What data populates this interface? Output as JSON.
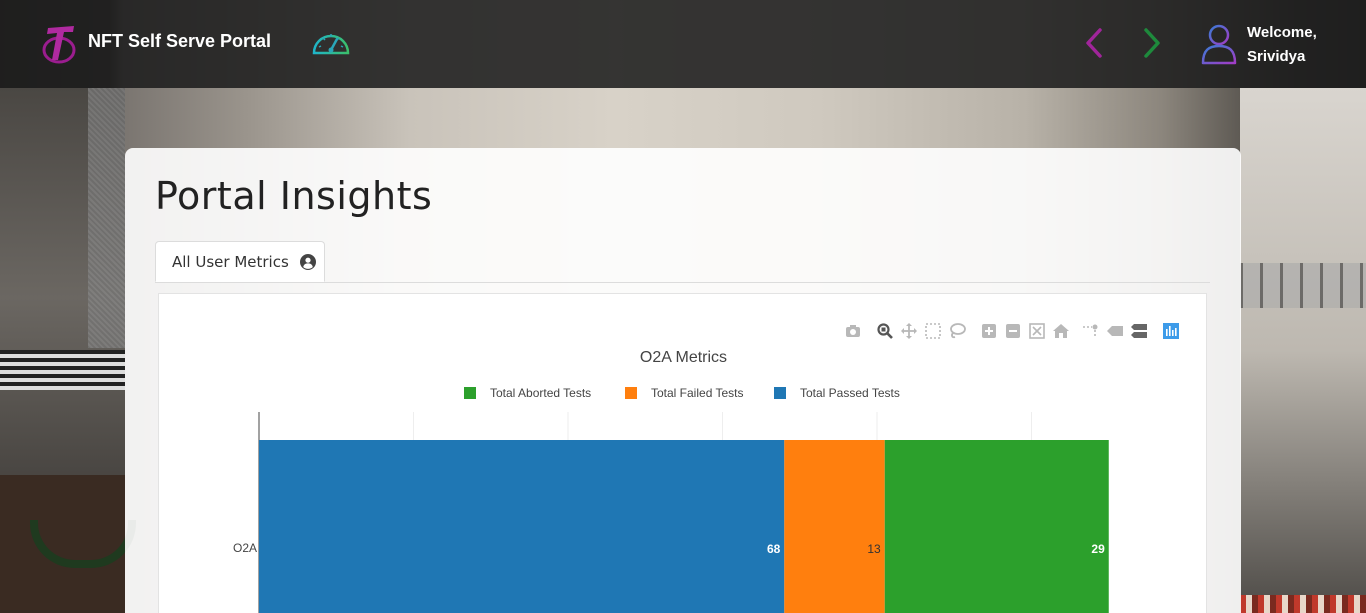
{
  "header": {
    "app_title": "NFT Self Serve Portal",
    "welcome_line1": "Welcome,",
    "welcome_line2": "Srividya"
  },
  "page": {
    "title": "Portal Insights",
    "tabs": [
      {
        "label": "All User Metrics",
        "icon": "user-circle-icon"
      }
    ]
  },
  "modebar": {
    "icons": [
      "camera-icon",
      "zoom-icon",
      "pan-icon",
      "box-select-icon",
      "lasso-select-icon",
      "zoom-in-icon",
      "zoom-out-icon",
      "autoscale-icon",
      "reset-axes-icon",
      "spike-lines-icon",
      "hover-closest-icon",
      "hover-compare-icon",
      "plotly-logo-icon"
    ]
  },
  "colors": {
    "passed": "#1f77b4",
    "failed": "#ff7f0e",
    "aborted": "#2ca02c",
    "accent_purple": "#a0259a",
    "accent_green": "#1e8a3c"
  },
  "chart_data": {
    "type": "bar",
    "orientation": "horizontal",
    "stacked": true,
    "title": "O2A Metrics",
    "categories": [
      "O2A"
    ],
    "series": [
      {
        "name": "Total Passed Tests",
        "values": [
          68
        ],
        "color": "#1f77b4"
      },
      {
        "name": "Total Failed Tests",
        "values": [
          13
        ],
        "color": "#ff7f0e"
      },
      {
        "name": "Total Aborted Tests",
        "values": [
          29
        ],
        "color": "#2ca02c"
      }
    ],
    "legend_order": [
      "Total Aborted Tests",
      "Total Failed Tests",
      "Total Passed Tests"
    ],
    "legend_position": "top-center",
    "xlim": [
      0,
      120
    ],
    "grid": true
  }
}
